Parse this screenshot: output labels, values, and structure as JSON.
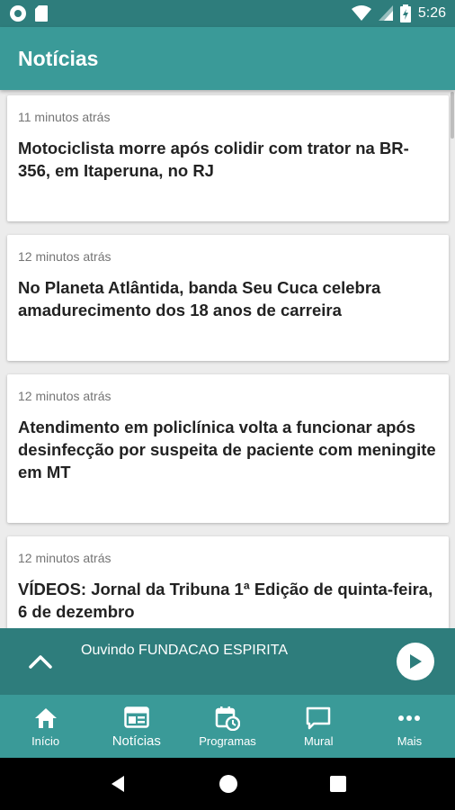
{
  "status_bar": {
    "time": "5:26",
    "icons": [
      "circle-notification-icon",
      "sd-card-icon",
      "wifi-icon",
      "cell-signal-icon",
      "battery-icon"
    ]
  },
  "app_bar": {
    "title": "Notícias"
  },
  "news": [
    {
      "time": "11 minutos atrás",
      "headline": "Motociclista morre após colidir com trator na BR-356, em Itaperuna, no RJ"
    },
    {
      "time": "12 minutos atrás",
      "headline": "No Planeta Atlântida, banda Seu Cuca celebra amadurecimento dos 18 anos de carreira"
    },
    {
      "time": "12 minutos atrás",
      "headline": "Atendimento em policlínica volta a funcionar após desinfecção por suspeita de paciente com meningite em MT"
    },
    {
      "time": "12 minutos atrás",
      "headline": "VÍDEOS: Jornal da Tribuna 1ª Edição de quinta-feira, 6 de dezembro"
    }
  ],
  "player": {
    "text": "Ouvindo FUNDACAO ESPIRITA",
    "expand_icon": "chevron-up-icon",
    "play_icon": "play-icon"
  },
  "bottom_nav": [
    {
      "label": "Início",
      "icon": "home-icon"
    },
    {
      "label": "Notícias",
      "icon": "newspaper-icon",
      "active": true
    },
    {
      "label": "Programas",
      "icon": "calendar-clock-icon"
    },
    {
      "label": "Mural",
      "icon": "chat-icon"
    },
    {
      "label": "Mais",
      "icon": "more-dots-icon"
    }
  ],
  "colors": {
    "app_bar": "#3a9a98",
    "status_bar": "#2e7d7c",
    "player": "#2e7d7c",
    "background": "#ececec"
  }
}
